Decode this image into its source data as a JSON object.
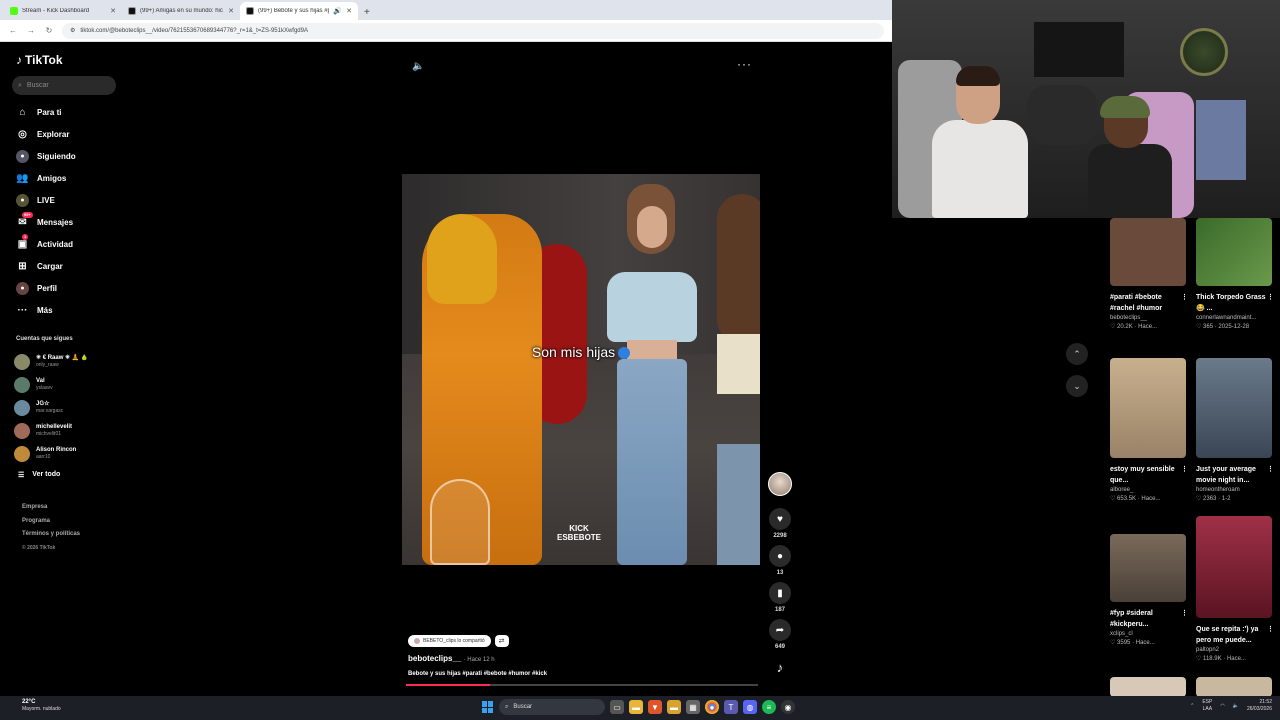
{
  "browser": {
    "tabs": [
      {
        "title": "Stream - Kick Dashboard",
        "color": "#53fc18"
      },
      {
        "title": "(99+) Amigas en su mundo: hic",
        "color": "#111111"
      },
      {
        "title": "(99+) Bebote y sus hijas #pa",
        "color": "#111111"
      }
    ],
    "new_tab": "+",
    "url": "tiktok.com/@beboteclips__/video/7621553670689344776?_r=1&_t=ZS-951kXwfgd9A"
  },
  "sidebar": {
    "logo": "TikTok",
    "search_placeholder": "Buscar",
    "nav": [
      {
        "label": "Para ti",
        "icon": "home-icon"
      },
      {
        "label": "Explorar",
        "icon": "compass-icon"
      },
      {
        "label": "Siguiendo",
        "icon": "following-icon"
      },
      {
        "label": "Amigos",
        "icon": "friends-icon"
      },
      {
        "label": "LIVE",
        "icon": "live-icon"
      },
      {
        "label": "Mensajes",
        "icon": "messages-icon",
        "badge": "99+"
      },
      {
        "label": "Actividad",
        "icon": "activity-icon",
        "badge": "1"
      },
      {
        "label": "Cargar",
        "icon": "upload-icon"
      },
      {
        "label": "Perfil",
        "icon": "profile-icon"
      },
      {
        "label": "Más",
        "icon": "more-icon"
      }
    ],
    "following_title": "Cuentas que sigues",
    "following": [
      {
        "name": "✳ € Raaw ✳ 🧘 🍐",
        "user": "only_raaw"
      },
      {
        "name": "Val",
        "user": "yslaavv"
      },
      {
        "name": "JG☆",
        "user": "mar.vargasc"
      },
      {
        "name": "michellevelit",
        "user": "michvelit01"
      },
      {
        "name": "Alison Rincon",
        "user": "aarr10"
      }
    ],
    "see_all": "Ver todo",
    "footer": [
      "Empresa",
      "Programa",
      "Términos y políticas"
    ],
    "copyright": "© 2026 TikTok"
  },
  "video": {
    "caption": "Son mis hijas",
    "watermark_line1": "KICK",
    "watermark_line2": "ESBEBOTE",
    "likes": "2298",
    "comments": "13",
    "saves": "187",
    "shares": "649",
    "shared_by": "BEBETO_clips lo compartió",
    "author": "beboteclips__",
    "time": "· Hace 12 h",
    "description": "Bebote y sus hijas #parati #bebote #humor #kick",
    "progress": 0.24,
    "accent": "#fe2c55"
  },
  "related": [
    {
      "title": "#parati #bebote #rachel #humor",
      "user": "beboteclips__",
      "likes": "20.2K",
      "date": "Hace...",
      "thumb": "#6a4a3a"
    },
    {
      "title": "Thick Torpedo Grass 😂 ...",
      "user": "connerlawnandmaint...",
      "likes": "365",
      "date": "2025-12-28",
      "thumb": "#4e7a3a"
    },
    {
      "title": "estoy muy sensible que...",
      "user": "alboree_",
      "likes": "653.5K",
      "date": "Hace...",
      "thumb": "#b5a088"
    },
    {
      "title": "Just your average movie night in...",
      "user": "homeontheroam",
      "likes": "2363",
      "date": "1-2",
      "thumb": "#4a5668"
    },
    {
      "title": "#fyp #sideral #kickperu...",
      "user": "xclips_cl",
      "likes": "3595",
      "date": "Hace...",
      "thumb": "#5a5048"
    },
    {
      "title": "Que se repita :') ya pero me puede...",
      "user": "paltopn2",
      "likes": "118.9K",
      "date": "Hace...",
      "thumb": "#7a2230"
    }
  ],
  "taskbar": {
    "temp": "22°C",
    "weather": "Mayorm. nublado",
    "search": "Buscar",
    "lang1": "ESP",
    "lang2": "LAA",
    "time": "21:52",
    "date": "26/03/2026"
  }
}
